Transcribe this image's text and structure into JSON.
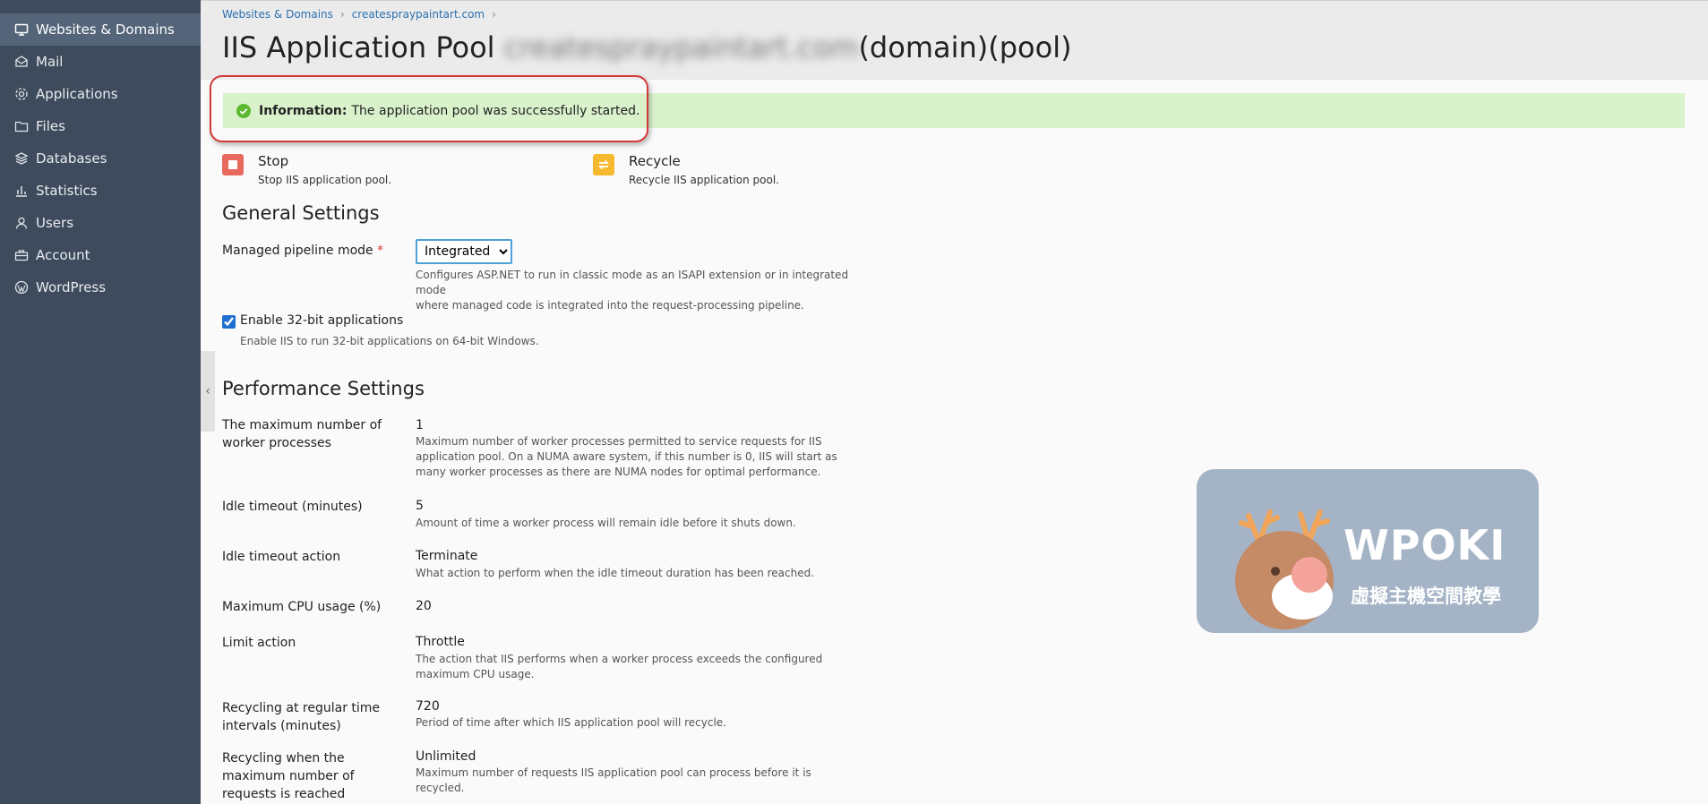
{
  "sidebar": {
    "items": [
      {
        "label": "Websites & Domains",
        "icon": "monitor-icon",
        "active": true
      },
      {
        "label": "Mail",
        "icon": "mail-icon"
      },
      {
        "label": "Applications",
        "icon": "gear-icon"
      },
      {
        "label": "Files",
        "icon": "folder-icon"
      },
      {
        "label": "Databases",
        "icon": "database-icon"
      },
      {
        "label": "Statistics",
        "icon": "bar-chart-icon"
      },
      {
        "label": "Users",
        "icon": "user-icon"
      },
      {
        "label": "Account",
        "icon": "briefcase-icon"
      },
      {
        "label": "WordPress",
        "icon": "wordpress-icon"
      }
    ]
  },
  "breadcrumb": {
    "items": [
      "Websites & Domains",
      "createspraypaintart.com"
    ]
  },
  "page": {
    "title_prefix": "IIS Application Pool",
    "title_blurred": "createspraypaintart.com",
    "title_suffix": "(domain)(pool)"
  },
  "info": {
    "label": "Information:",
    "message": "The application pool was successfully started."
  },
  "actions": {
    "stop": {
      "title": "Stop",
      "desc": "Stop IIS application pool."
    },
    "recycle": {
      "title": "Recycle",
      "desc": "Recycle IIS application pool."
    }
  },
  "general": {
    "heading": "General Settings",
    "pipeline_label": "Managed pipeline mode",
    "required_mark": "*",
    "pipeline_value": "Integrated",
    "pipeline_help_1": "Configures ASP.NET to run in classic mode as an ISAPI extension or in integrated mode",
    "pipeline_help_2": "where managed code is integrated into the request-processing pipeline.",
    "enable32_label": "Enable 32-bit applications",
    "enable32_help": "Enable IIS to run 32-bit applications on 64-bit Windows.",
    "enable32_checked": true
  },
  "performance": {
    "heading": "Performance Settings",
    "rows": [
      {
        "label": "The maximum number of worker processes",
        "value": "1",
        "help": "Maximum number of worker processes permitted to service requests for IIS application pool. On a NUMA aware system, if this number is 0, IIS will start as many worker processes as there are NUMA nodes for optimal performance."
      },
      {
        "label": "Idle timeout (minutes)",
        "value": "5",
        "help": "Amount of time a worker process will remain idle before it shuts down."
      },
      {
        "label": "Idle timeout action",
        "value": "Terminate",
        "help": "What action to perform when the idle timeout duration has been reached."
      },
      {
        "label": "Maximum CPU usage (%)",
        "value": "20",
        "help": ""
      },
      {
        "label": "Limit action",
        "value": "Throttle",
        "help": "The action that IIS performs when a worker process exceeds the configured maximum CPU usage."
      },
      {
        "label": "Recycling at regular time intervals (minutes)",
        "value": "720",
        "help": "Period of time after which IIS application pool will recycle."
      },
      {
        "label": "Recycling when the maximum number of requests is reached",
        "value": "Unlimited",
        "help": "Maximum number of requests IIS application pool can process before it is recycled."
      }
    ]
  },
  "watermark": {
    "brand": "WPOKI",
    "subtitle": "虛擬主機空間教學"
  },
  "colors": {
    "sidebar_bg": "#3e4b5c",
    "info_bg": "#d9f2cc",
    "stop_icon": "#e86a5f",
    "recycle_icon": "#f5b82e",
    "link": "#2a6fb0",
    "highlight": "#d23a35"
  }
}
